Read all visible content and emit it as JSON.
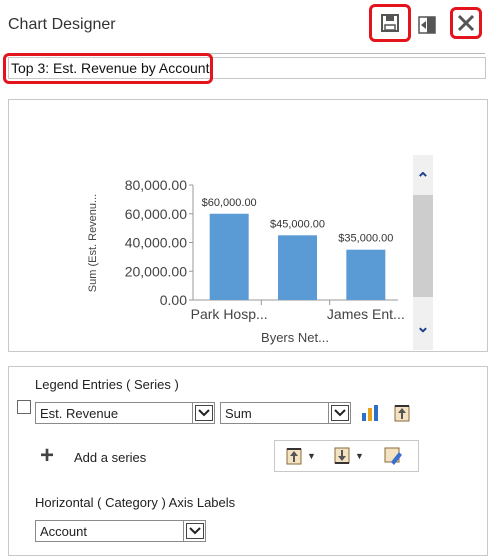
{
  "window": {
    "title": "Chart Designer"
  },
  "header": {
    "save_icon": "save-icon",
    "dock_icon": "dock-icon",
    "close_icon": "close-icon"
  },
  "chart_name": {
    "value": "Top 3: Est. Revenue by Account"
  },
  "chart_data": {
    "type": "bar",
    "categories": [
      "Park Hosp...",
      "",
      "James Ent..."
    ],
    "values": [
      60000,
      45000,
      35000
    ],
    "data_labels": [
      "$60,000.00",
      "$45,000.00",
      "$35,000.00"
    ],
    "ylabel": "Sum (Est. Revenu...",
    "xlabel": "Byers Net...",
    "ylim": [
      0,
      80000
    ],
    "yticks": [
      "80,000.00",
      "60,000.00",
      "40,000.00",
      "20,000.00",
      "0.00"
    ],
    "color": "#5b9bd5",
    "grid": false
  },
  "config": {
    "legend_label": "Legend Entries ( Series )",
    "series_select": "Est. Revenue",
    "aggregate_select": "Sum",
    "add_series_label": "Add a series",
    "category_label": "Horizontal ( Category ) Axis Labels",
    "category_select": "Account"
  }
}
